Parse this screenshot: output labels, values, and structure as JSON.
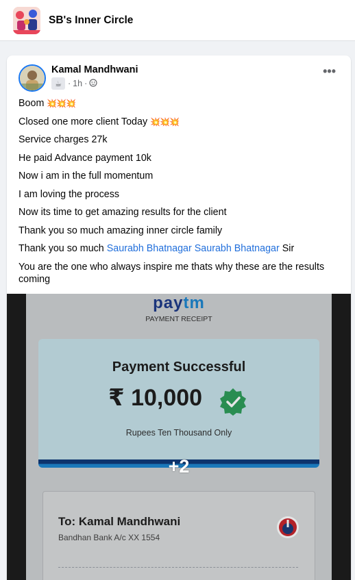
{
  "group": {
    "name": "SB's Inner Circle"
  },
  "post": {
    "author": "Kamal Mandhwani",
    "time": "1h",
    "separator": "·",
    "audience_icon": "globe-icon",
    "more_label": "•••",
    "lines": {
      "l1": "Boom",
      "l1_emoji": "💥💥💥",
      "l2": "Closed one more client Today",
      "l2_emoji": "💥💥💥",
      "l3": "Service charges 27k",
      "l4": "He paid Advance payment 10k",
      "l5": "Now i am in the full momentum",
      "l6": "I am loving the process",
      "l7": "Now its time to get amazing results for the client",
      "l8": "Thank you so much amazing inner circle family",
      "l9_prefix": "Thank you so much",
      "l9_mention1": "Saurabh Bhatnagar",
      "l9_mention2": "Saurabh Bhatnagar",
      "l9_suffix": "Sir",
      "l10": "You are the one who always inspire me thats why these are the results coming"
    }
  },
  "media": {
    "brand_a": "pay",
    "brand_b": "tm",
    "receipt_label": "PAYMENT RECEIPT",
    "success_title": "Payment Successful",
    "amount": "₹ 10,000",
    "amount_words": "Rupees Ten Thousand Only",
    "more_count": "+2",
    "to_label": "To: Kamal Mandhwani",
    "bank": "Bandhan Bank A/c XX 1554"
  },
  "colors": {
    "accent": "#1877f2",
    "mention": "#216fdb",
    "success_box": "#c7e2ea",
    "check_green": "#2e9e5b"
  }
}
